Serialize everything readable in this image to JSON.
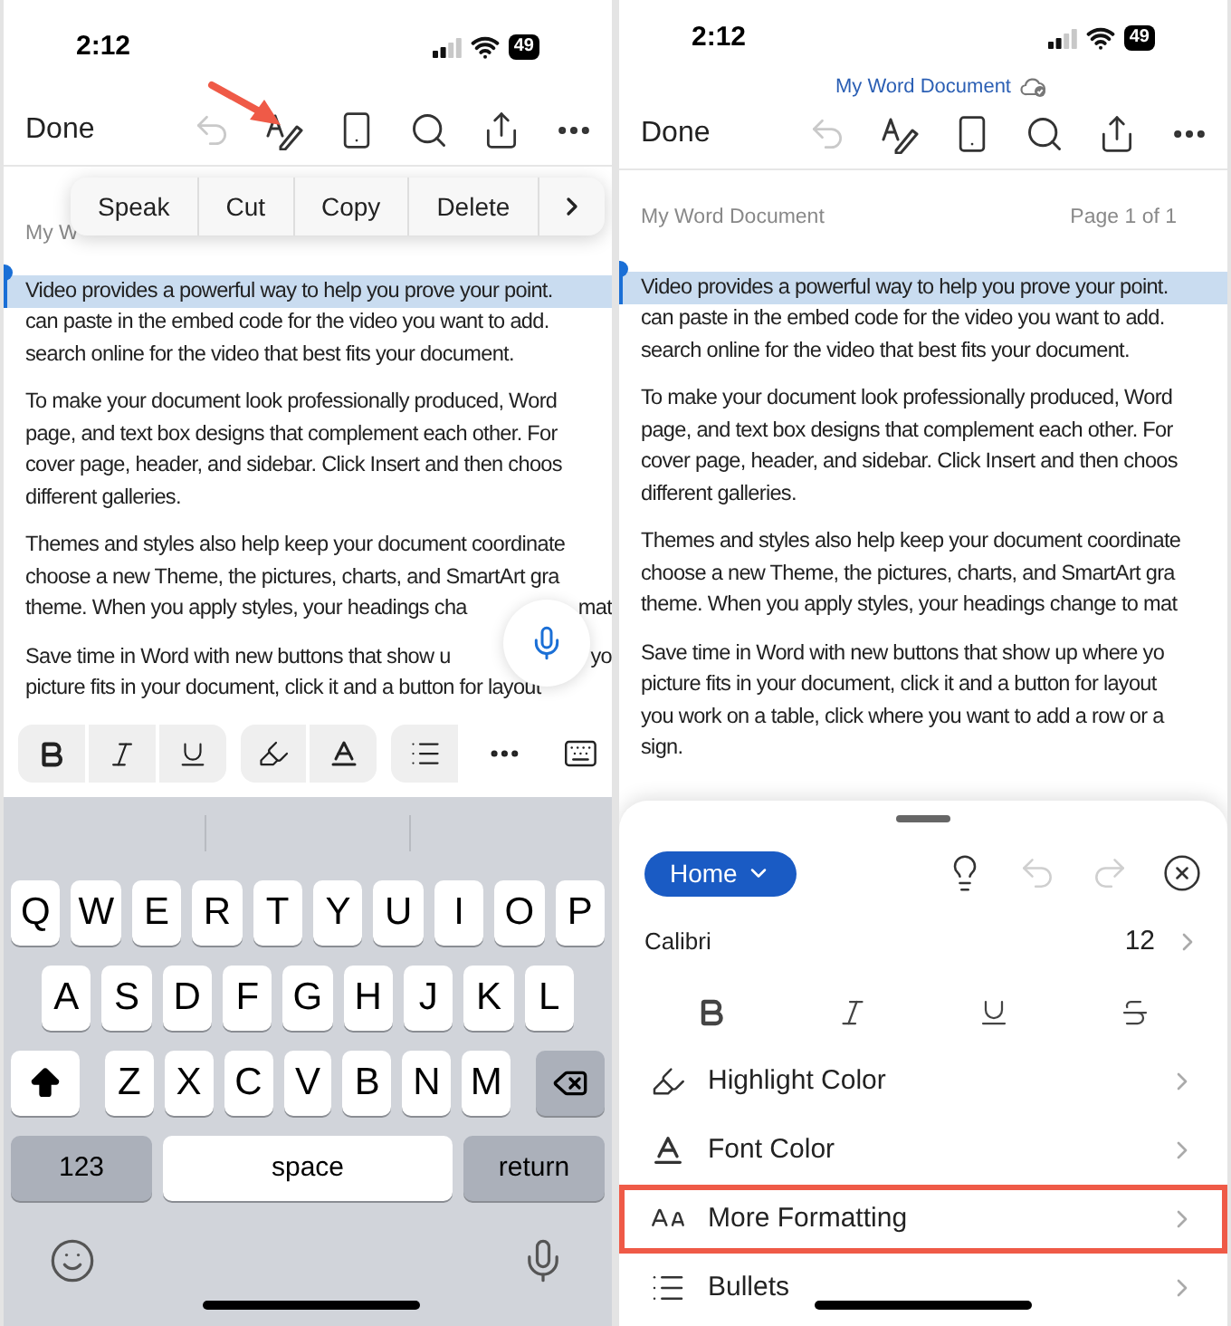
{
  "left_screen": {
    "status_bar": {
      "time": "2:12",
      "battery": "49"
    },
    "toolbar": {
      "done": "Done",
      "undo_enabled": false
    },
    "context_menu": [
      {
        "label": "Speak"
      },
      {
        "label": "Cut"
      },
      {
        "label": "Copy"
      },
      {
        "label": "Delete"
      }
    ],
    "document": {
      "header": "My W",
      "paragraphs": [
        {
          "lines": [
            {
              "text": "Video provides a powerful way to help you prove your point.",
              "selected": true
            },
            {
              "text": "can paste in the embed code for the video you want to add.",
              "selected": false
            },
            {
              "text": "search online for the video that best fits your document.",
              "selected": false
            }
          ]
        },
        {
          "lines": [
            {
              "text": "To make your document look professionally produced, Word",
              "selected": false
            },
            {
              "text": "page, and text box designs that complement each other. For",
              "selected": false
            },
            {
              "text": "cover page, header, and sidebar. Click Insert and then choos",
              "selected": false
            },
            {
              "text": "different galleries.",
              "selected": false
            }
          ]
        },
        {
          "lines": [
            {
              "text": "Themes and styles also help keep your document coordinate",
              "selected": false
            },
            {
              "text": "choose a new Theme, the pictures, charts, and SmartArt gra",
              "selected": false
            },
            {
              "text": "theme. When you apply styles, your headings cha",
              "text_after_mic": "mat",
              "selected": false
            }
          ]
        },
        {
          "lines": [
            {
              "text": "Save time in Word with new buttons that show u",
              "text_after_mic": "yo",
              "selected": false
            },
            {
              "text": "picture fits in your document, click it and a button for layout",
              "selected": false
            }
          ]
        }
      ]
    },
    "keyboard": {
      "rows": [
        [
          "Q",
          "W",
          "E",
          "R",
          "T",
          "Y",
          "U",
          "I",
          "O",
          "P"
        ],
        [
          "A",
          "S",
          "D",
          "F",
          "G",
          "H",
          "J",
          "K",
          "L"
        ],
        [
          "Z",
          "X",
          "C",
          "V",
          "B",
          "N",
          "M"
        ]
      ],
      "numbers_key": "123",
      "space_key": "space",
      "return_key": "return"
    }
  },
  "right_screen": {
    "status_bar": {
      "time": "2:12",
      "battery": "49"
    },
    "document_title": "My Word Document",
    "toolbar": {
      "done": "Done",
      "undo_enabled": false
    },
    "document": {
      "header": "My Word Document",
      "page_info": "Page 1 of 1",
      "paragraphs": [
        {
          "lines": [
            {
              "text": "Video provides a powerful way to help you prove your point.",
              "selected": true
            },
            {
              "text": "can paste in the embed code for the video you want to add.",
              "selected": false
            },
            {
              "text": "search online for the video that best fits your document.",
              "selected": false
            }
          ]
        },
        {
          "lines": [
            {
              "text": "To make your document look professionally produced, Word",
              "selected": false
            },
            {
              "text": "page, and text box designs that complement each other. For",
              "selected": false
            },
            {
              "text": "cover page, header, and sidebar. Click Insert and then choos",
              "selected": false
            },
            {
              "text": "different galleries.",
              "selected": false
            }
          ]
        },
        {
          "lines": [
            {
              "text": "Themes and styles also help keep your document coordinate",
              "selected": false
            },
            {
              "text": "choose a new Theme, the pictures, charts, and SmartArt gra",
              "selected": false
            },
            {
              "text": "theme. When you apply styles, your headings change to mat",
              "selected": false
            }
          ]
        },
        {
          "lines": [
            {
              "text": "Save time in Word with new buttons that show up where yo",
              "selected": false
            },
            {
              "text": "picture fits in your document, click it and a button for layout",
              "selected": false
            },
            {
              "text": "you work on a table, click where you want to add a row or a",
              "selected": false
            },
            {
              "text": "sign.",
              "selected": false
            }
          ]
        }
      ]
    },
    "ribbon": {
      "tab_menu": "Home",
      "undo_enabled": false,
      "redo_enabled": false,
      "font_name": "Calibri",
      "font_size": "12",
      "items": [
        {
          "label": "Highlight Color",
          "kind": "highlight",
          "highlighted": false
        },
        {
          "label": "Font Color",
          "kind": "font-color",
          "highlighted": false
        },
        {
          "label": "More Formatting",
          "kind": "more-formatting",
          "highlighted": true
        },
        {
          "label": "Bullets",
          "kind": "bullets",
          "highlighted": false
        }
      ]
    }
  }
}
